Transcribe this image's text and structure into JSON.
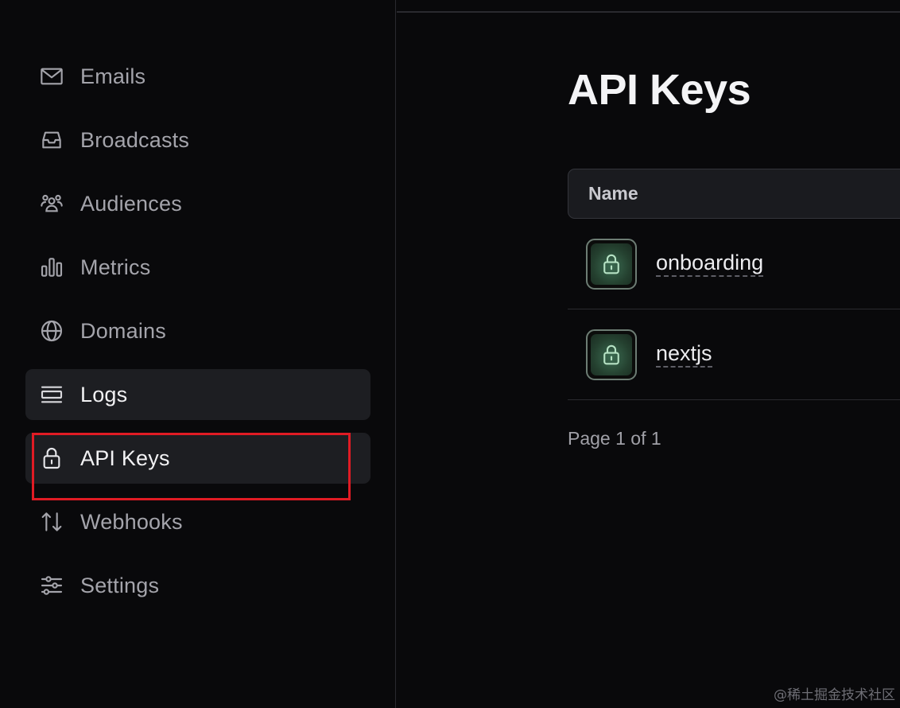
{
  "sidebar": {
    "items": [
      {
        "label": "Emails",
        "icon": "mail-icon"
      },
      {
        "label": "Broadcasts",
        "icon": "inbox-tray-icon"
      },
      {
        "label": "Audiences",
        "icon": "users-icon"
      },
      {
        "label": "Metrics",
        "icon": "bar-chart-icon"
      },
      {
        "label": "Domains",
        "icon": "globe-icon"
      },
      {
        "label": "Logs",
        "icon": "list-lines-icon"
      },
      {
        "label": "API Keys",
        "icon": "lock-icon"
      },
      {
        "label": "Webhooks",
        "icon": "arrows-up-down-icon"
      },
      {
        "label": "Settings",
        "icon": "sliders-icon"
      }
    ],
    "active_index": 6
  },
  "main": {
    "title": "API Keys",
    "table": {
      "header": "Name",
      "rows": [
        {
          "name": "onboarding",
          "icon": "lock-icon"
        },
        {
          "name": "nextjs",
          "icon": "lock-icon"
        }
      ]
    },
    "pagination": "Page 1 of 1"
  },
  "watermark": "@稀土掘金技术社区",
  "colors": {
    "background": "#09090b",
    "active_item": "#1d1e22",
    "highlight": "#e01b24",
    "key_icon_green": "#3b6b51"
  }
}
